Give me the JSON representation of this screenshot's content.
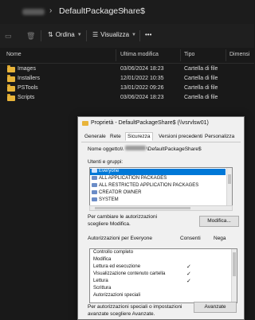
{
  "explorer": {
    "breadcrumb_sep": "›",
    "current_folder": "DefaultPackageShare$",
    "toolbar": {
      "new_icon": "new-icon",
      "delete_icon": "trash-icon",
      "sort_label": "Ordina",
      "view_label": "Visualizza",
      "more_label": "•••"
    },
    "columns": [
      "Nome",
      "Ultima modifica",
      "Tipo",
      "Dimensi"
    ],
    "rows": [
      {
        "name": "Images",
        "modified": "03/06/2024 18:23",
        "type": "Cartella di file"
      },
      {
        "name": "Installers",
        "modified": "12/01/2022 10:35",
        "type": "Cartella di file"
      },
      {
        "name": "PSTools",
        "modified": "13/01/2022 09:26",
        "type": "Cartella di file"
      },
      {
        "name": "Scripts",
        "modified": "03/06/2024 18:23",
        "type": "Cartella di file"
      }
    ]
  },
  "dialog": {
    "title": "Proprietà - DefaultPackageShare$ (\\\\vsrvlsw01)",
    "tabs": [
      "Generale",
      "Rete",
      "Sicurezza",
      "Versioni precedenti",
      "Personalizza"
    ],
    "object_label": "Nome oggetto:",
    "object_value_prefix": "\\\\",
    "object_value_suffix": "\\DefaultPackageShare$",
    "users_label": "Utenti e gruppi:",
    "users": [
      "Everyone",
      "ALL APPLICATION PACKAGES",
      "ALL RESTRICTED APPLICATION PACKAGES",
      "CREATOR OWNER",
      "SYSTEM"
    ],
    "change_hint_line1": "Per cambiare le autorizzazioni",
    "change_hint_line2": "scegliere Modifica.",
    "modify_button": "Modifica...",
    "perm_header": "Autorizzazioni per Everyone",
    "allow_header": "Consenti",
    "deny_header": "Nega",
    "permissions": [
      {
        "name": "Controllo completo",
        "allow": ""
      },
      {
        "name": "Modifica",
        "allow": ""
      },
      {
        "name": "Lettura ed esecuzione",
        "allow": "✓"
      },
      {
        "name": "Visualizzazione contenuto cartella",
        "allow": "✓"
      },
      {
        "name": "Lettura",
        "allow": "✓"
      },
      {
        "name": "Scrittura",
        "allow": ""
      },
      {
        "name": "Autorizzazioni speciali",
        "allow": ""
      }
    ],
    "advanced_hint_line1": "Per autorizzazioni speciali o impostazioni",
    "advanced_hint_line2": "avanzate scegliere Avanzate.",
    "advanced_button": "Avanzate"
  }
}
